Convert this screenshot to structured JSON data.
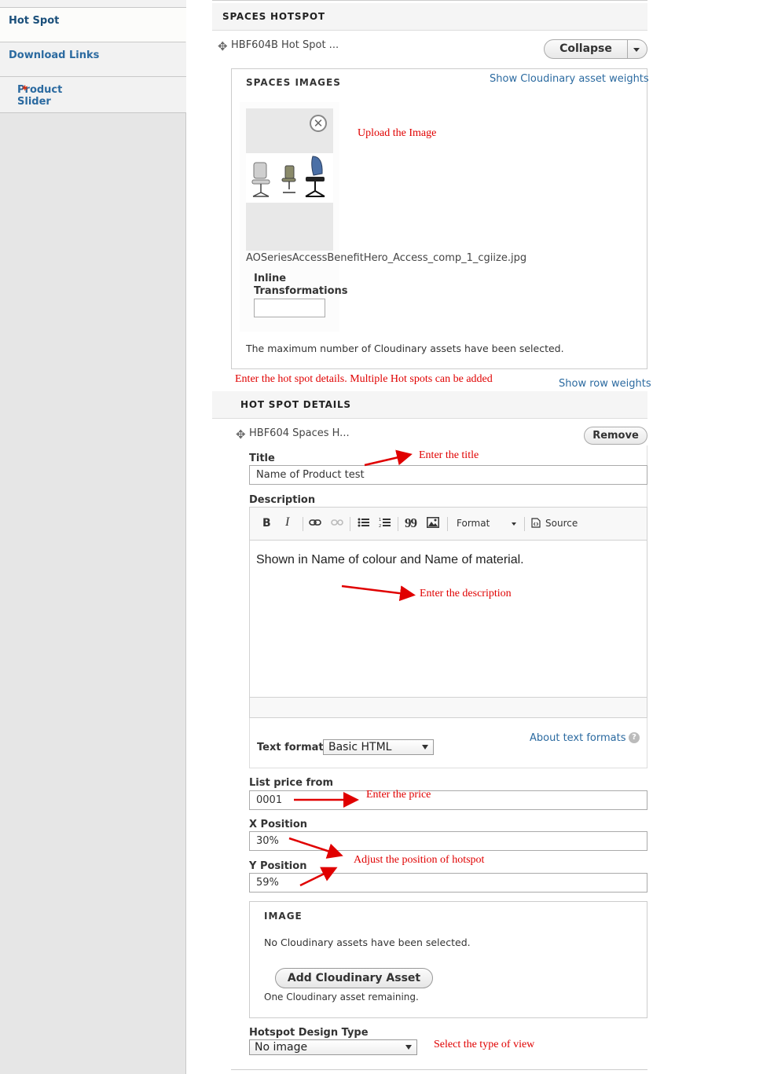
{
  "sidebar": {
    "items": [
      {
        "label": "Hot Spot",
        "required": false
      },
      {
        "label": "Download Links",
        "required": false
      },
      {
        "label": "Product Slider",
        "required": true,
        "required_mark": "*"
      }
    ]
  },
  "hotspot_section": {
    "title": "SPACES HOTSPOT",
    "row_title": "HBF604B Hot Spot ...",
    "collapse_label": "Collapse",
    "images": {
      "legend": "SPACES IMAGES",
      "weights_link": "Show Cloudinary asset weights",
      "filename": "AOSeriesAccessBenefitHero_Access_comp_1_cgiize.jpg",
      "inline_label_1": "Inline",
      "inline_label_2": "Transformations",
      "inline_value": "",
      "max_note": "The maximum number of Cloudinary assets have been selected."
    },
    "row_weights_link": "Show row weights"
  },
  "details": {
    "title": "HOT SPOT DETAILS",
    "row_title": "HBF604 Spaces H...",
    "remove_label": "Remove",
    "title_label": "Title",
    "title_value": "Name of Product test",
    "description_label": "Description",
    "toolbar": {
      "bold": "B",
      "italic": "I",
      "quote": "99",
      "format": "Format",
      "source": "Source"
    },
    "description_text": "Shown in Name of colour and Name of material.",
    "text_format_label": "Text format",
    "text_format_value": "Basic HTML",
    "about_formats": "About text formats",
    "help_glyph": "?",
    "price_label": "List price from",
    "price_value": "0001",
    "x_label": "X Position",
    "x_value": "30%",
    "y_label": "Y Position",
    "y_value": "59%",
    "image_legend": "IMAGE",
    "image_note": "No Cloudinary assets have been selected.",
    "add_asset_label": "Add Cloudinary Asset",
    "remaining_note": "One Cloudinary asset remaining.",
    "design_type_label": "Hotspot Design Type",
    "design_type_value": "No image"
  },
  "annotations": {
    "upload": "Upload the Image",
    "hotspot_details": "Enter the hot spot details. Multiple Hot spots can be added",
    "title": "Enter the title",
    "description": "Enter the description",
    "price": "Enter the price",
    "position": "Adjust the position of hotspot",
    "view_type": "Select the type of view"
  },
  "colors": {
    "link": "#2b6aa0",
    "annotation": "#e00000",
    "required": "#e32700"
  }
}
